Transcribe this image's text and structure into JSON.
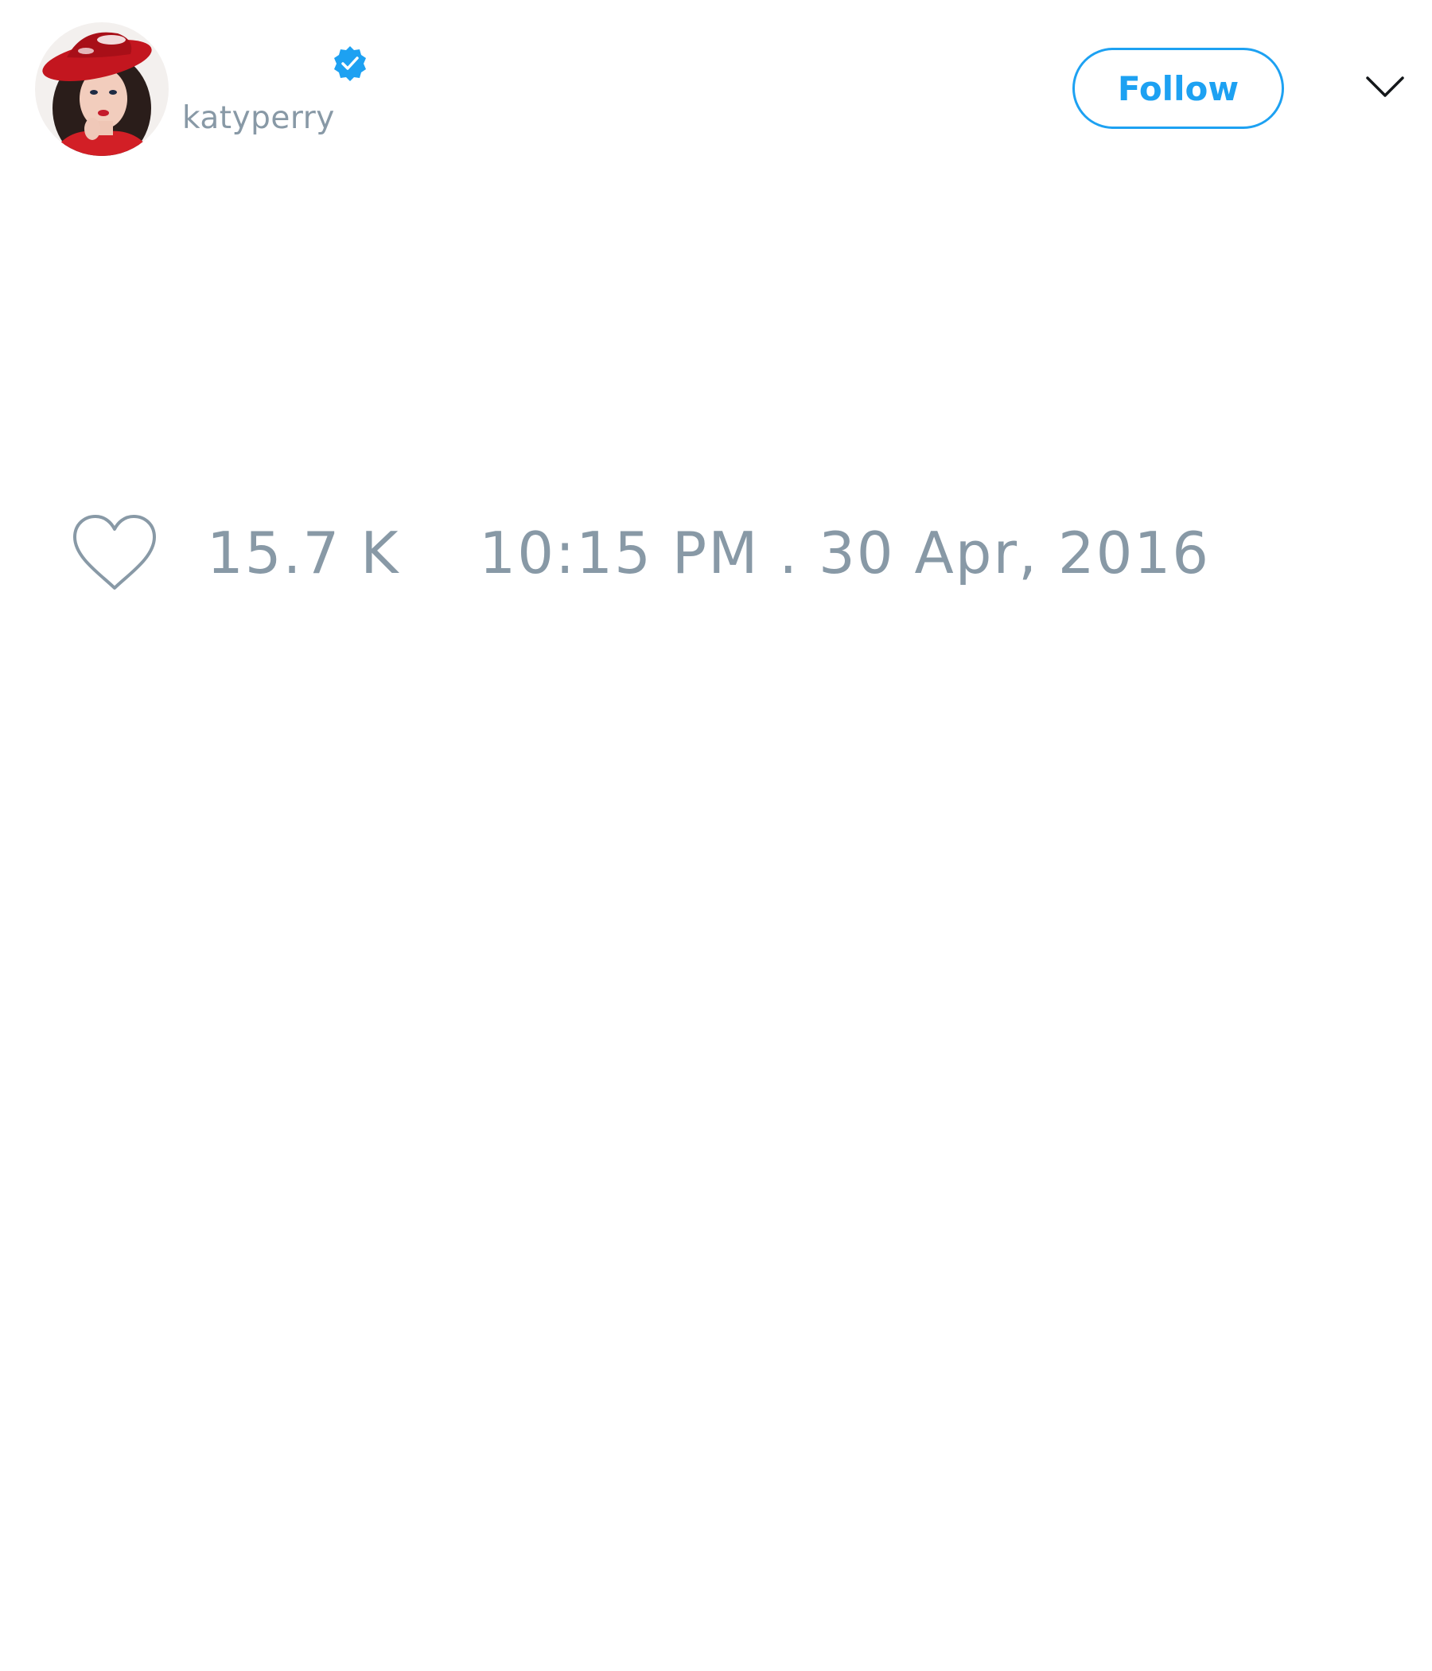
{
  "author": {
    "display_name": "",
    "username": "katyperry",
    "verified": true,
    "avatar": "profile-photo"
  },
  "header": {
    "follow_label": "Follow",
    "menu_icon": "chevron-down-icon"
  },
  "stats": {
    "like_icon": "heart-outline-icon",
    "like_count": "15.7 K"
  },
  "meta": {
    "timestamp": "10:15 PM . 30 Apr, 2016"
  },
  "colors": {
    "accent": "#1da1f2",
    "secondary_text": "#8899a6",
    "background": "#ffffff"
  }
}
